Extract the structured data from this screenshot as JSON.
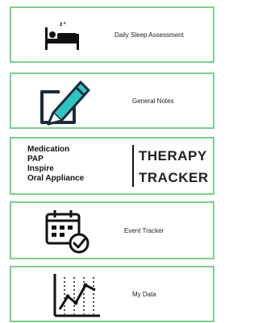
{
  "menu": {
    "items": [
      {
        "label": "Daily Sleep Assessment",
        "icon": "bed-sleep-icon"
      },
      {
        "label": "General Notes",
        "icon": "pencil-notepad-icon"
      },
      {
        "therapy_list": [
          "Medication",
          "PAP",
          "Inspire",
          "Oral Appliance"
        ],
        "title_line1": "THERAPY",
        "title_line2": "TRACKER"
      },
      {
        "label": "Event Tracker",
        "icon": "calendar-check-icon"
      },
      {
        "label": "My Data",
        "icon": "line-chart-icon"
      }
    ]
  },
  "colors": {
    "card_border": "#7bd08a",
    "accent_teal": "#2ec4c4",
    "ink": "#111111"
  }
}
